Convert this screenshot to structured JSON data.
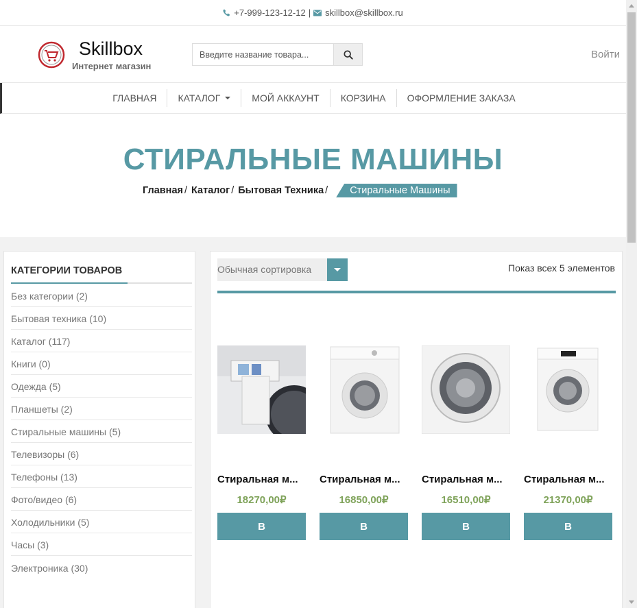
{
  "topbar": {
    "phone": "+7-999-123-12-12",
    "separator": "|",
    "email": "skillbox@skillbox.ru"
  },
  "header": {
    "logo_title": "Skillbox",
    "logo_subtitle": "Интернет магазин",
    "search_placeholder": "Введите название товара...",
    "login": "Войти"
  },
  "nav": {
    "items": [
      {
        "label": "ГЛАВНАЯ"
      },
      {
        "label": "КАТАЛОГ",
        "has_dropdown": true
      },
      {
        "label": "МОЙ АККАУНТ"
      },
      {
        "label": "КОРЗИНА"
      },
      {
        "label": "ОФОРМЛЕНИЕ ЗАКАЗА"
      }
    ]
  },
  "hero": {
    "title": "СТИРАЛЬНЫЕ МАШИНЫ",
    "breadcrumbs": [
      "Главная",
      "Каталог",
      "Бытовая Техника"
    ],
    "breadcrumb_separator": "/",
    "breadcrumb_current": "Стиральные Машины"
  },
  "sidebar": {
    "title": "КАТЕГОРИИ ТОВАРОВ",
    "categories": [
      "Без категории (2)",
      "Бытовая техника (10)",
      "Каталог (117)",
      "Книги (0)",
      "Одежда (5)",
      "Планшеты (2)",
      "Стиральные машины (5)",
      "Телевизоры (6)",
      "Телефоны (13)",
      "Фото/видео (6)",
      "Холодильники (5)",
      "Часы (3)",
      "Электроника (30)"
    ]
  },
  "shop": {
    "sort_label": "Обычная сортировка",
    "result_count": "Показ всех 5 элементов",
    "products": [
      {
        "name": "Стиральная м...",
        "price": "18270,00₽",
        "button": "В"
      },
      {
        "name": "Стиральная м...",
        "price": "16850,00₽",
        "button": "В"
      },
      {
        "name": "Стиральная м...",
        "price": "16510,00₽",
        "button": "В"
      },
      {
        "name": "Стиральная м...",
        "price": "21370,00₽",
        "button": "В"
      }
    ]
  },
  "colors": {
    "accent": "#5799a4",
    "price": "#7fa35a",
    "logo_red": "#c0282e"
  }
}
